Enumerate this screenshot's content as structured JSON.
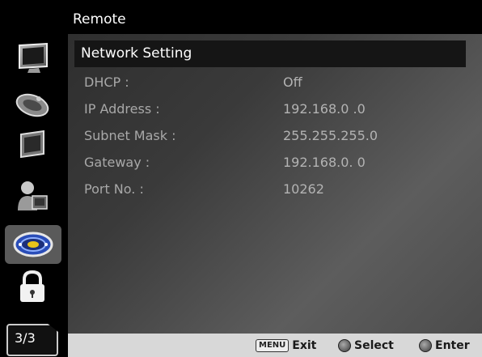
{
  "menu": {
    "title": "Remote"
  },
  "submenu": {
    "title": "Network Setting"
  },
  "settings": [
    {
      "label": "DHCP :",
      "value": "Off"
    },
    {
      "label": "IP Address :",
      "value": "192.168.0 .0"
    },
    {
      "label": "Subnet Mask :",
      "value": "255.255.255.0"
    },
    {
      "label": "Gateway :",
      "value": "192.168.0. 0"
    },
    {
      "label": "Port No. :",
      "value": "10262"
    }
  ],
  "sidebar": {
    "icons": [
      "monitor-icon",
      "satellite-dish-icon",
      "screen-icon",
      "user-pc-icon",
      "network-icon",
      "lock-icon"
    ],
    "active_icon": "network-icon",
    "page": "3/3"
  },
  "footer": {
    "menu_key": "MENU",
    "exit_label": "Exit",
    "select_label": "Select",
    "enter_label": "Enter"
  },
  "colors": {
    "background": "#000000",
    "panel_gradient_mid": "#5d5d5d",
    "footer": "#d8d8d8",
    "active_icon_bg": "#5a5a5a",
    "network_icon_blue": "#2a4db8"
  }
}
